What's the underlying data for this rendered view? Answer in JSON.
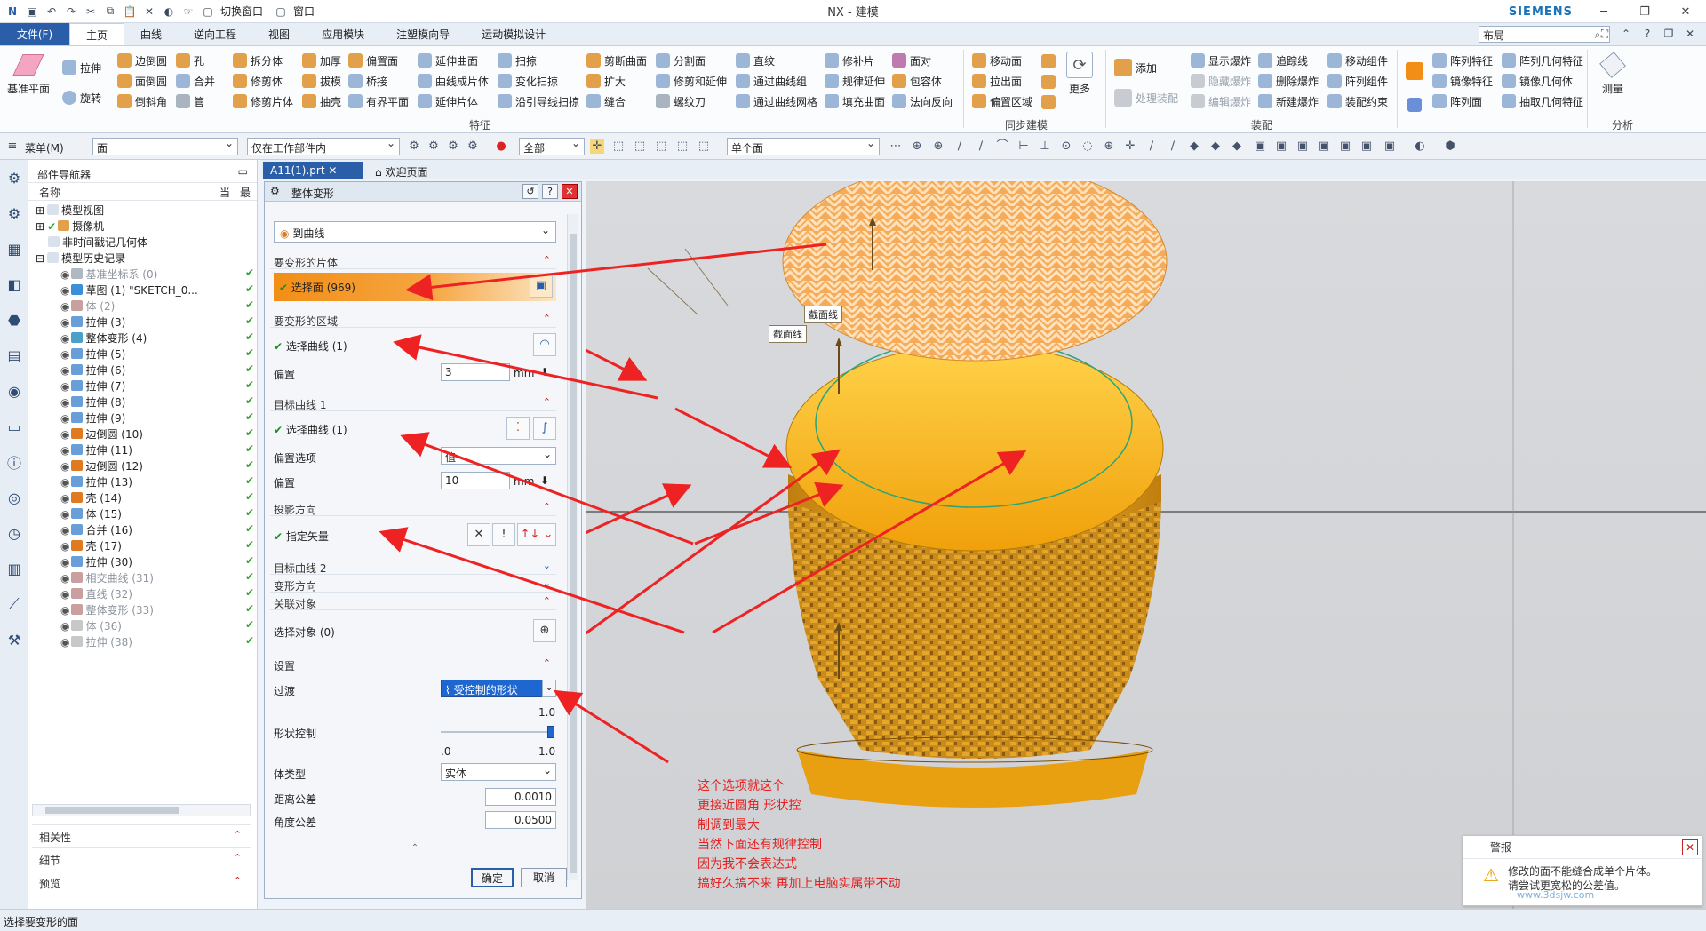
{
  "titlebar": {
    "title": "NX - 建模",
    "brand": "SIEMENS",
    "switch_window": "切换窗口",
    "window": "窗口"
  },
  "tabs": {
    "file": "文件(F)",
    "items": [
      "主页",
      "曲线",
      "逆向工程",
      "视图",
      "应用模块",
      "注塑模向导",
      "运动模拟设计"
    ],
    "search_value": "布局"
  },
  "ribbon": {
    "big": {
      "datum_plane": "基准平面",
      "extrude": "拉伸",
      "revolve": "旋转",
      "add": "添加",
      "process_assembly": "处理装配",
      "more": "更多",
      "measure": "测量"
    },
    "col1": [
      "边倒圆",
      "面倒圆",
      "倒斜角"
    ],
    "col2": [
      "孔",
      "合并",
      "管"
    ],
    "col3": [
      "拆分体",
      "修剪体",
      "修剪片体"
    ],
    "col4": [
      "加厚",
      "拔模",
      "抽壳"
    ],
    "col5": [
      "偏置面",
      "桥接",
      "有界平面"
    ],
    "col6": [
      "延伸曲面",
      "曲线成片体",
      "延伸片体"
    ],
    "col7": [
      "扫掠",
      "变化扫掠",
      "沿引导线扫掠"
    ],
    "col8": [
      "剪断曲面",
      "扩大",
      "缝合"
    ],
    "col9": [
      "分割面",
      "修剪和延伸",
      "螺纹刀"
    ],
    "col10": [
      "直纹",
      "通过曲线组",
      "通过曲线网格"
    ],
    "col11": [
      "修补片",
      "规律延伸",
      "填充曲面"
    ],
    "col12": [
      "面对",
      "包容体",
      "法向反向"
    ],
    "col13": [
      "移动面",
      "拉出面",
      "偏置区域"
    ],
    "col14": [
      "显示爆炸",
      "隐藏爆炸",
      "编辑爆炸"
    ],
    "col15": [
      "追踪线",
      "删除爆炸",
      "新建爆炸"
    ],
    "col16": [
      "移动组件",
      "阵列组件",
      "装配约束"
    ],
    "col17": [
      "阵列特征",
      "镜像特征",
      "阵列面"
    ],
    "col18": [
      "阵列几何特征",
      "镜像几何体",
      "抽取几何特征"
    ],
    "groups": [
      "特征",
      "同步建模",
      "装配",
      "分析"
    ]
  },
  "selbar": {
    "menu": "菜单(M)",
    "filter": "面",
    "scope": "仅在工作部件内",
    "all": "全部",
    "single_face": "单个面"
  },
  "navigator": {
    "title": "部件导航器",
    "col_name": "名称",
    "col_current": "当",
    "col_latest": "最",
    "top_items": [
      "模型视图",
      "摄像机",
      "非时间戳记几何体",
      "模型历史记录"
    ],
    "history": [
      {
        "label": "基准坐标系 (0)",
        "dim": true,
        "color": "#b0b8c2"
      },
      {
        "label": "草图 (1) \"SKETCH_0...",
        "dim": false,
        "color": "#3a8fd8"
      },
      {
        "label": "体 (2)",
        "dim": true,
        "color": "#c8a0a0"
      },
      {
        "label": "拉伸 (3)",
        "dim": false,
        "color": "#6a9ed8"
      },
      {
        "label": "整体变形 (4)",
        "dim": false,
        "color": "#4aa0c8"
      },
      {
        "label": "拉伸 (5)",
        "dim": false,
        "color": "#6a9ed8"
      },
      {
        "label": "拉伸 (6)",
        "dim": false,
        "color": "#6a9ed8"
      },
      {
        "label": "拉伸 (7)",
        "dim": false,
        "color": "#6a9ed8"
      },
      {
        "label": "拉伸 (8)",
        "dim": false,
        "color": "#6a9ed8"
      },
      {
        "label": "拉伸 (9)",
        "dim": false,
        "color": "#6a9ed8"
      },
      {
        "label": "边倒圆 (10)",
        "dim": false,
        "color": "#e07a20"
      },
      {
        "label": "拉伸 (11)",
        "dim": false,
        "color": "#6a9ed8"
      },
      {
        "label": "边倒圆 (12)",
        "dim": false,
        "color": "#e07a20"
      },
      {
        "label": "拉伸 (13)",
        "dim": false,
        "color": "#6a9ed8"
      },
      {
        "label": "壳 (14)",
        "dim": false,
        "color": "#e07a20"
      },
      {
        "label": "体 (15)",
        "dim": false,
        "color": "#6a9ed8"
      },
      {
        "label": "合并 (16)",
        "dim": false,
        "color": "#6a9ed8"
      },
      {
        "label": "壳 (17)",
        "dim": false,
        "color": "#e07a20"
      },
      {
        "label": "拉伸 (30)",
        "dim": false,
        "color": "#6a9ed8"
      },
      {
        "label": "相交曲线 (31)",
        "dim": true,
        "color": "#c8a0a0"
      },
      {
        "label": "直线 (32)",
        "dim": true,
        "color": "#c8a0a0"
      },
      {
        "label": "整体变形 (33)",
        "dim": true,
        "color": "#c8a0a0"
      },
      {
        "label": "体 (36)",
        "dim": true,
        "color": "#c8c8c8"
      },
      {
        "label": "拉伸 (38)",
        "dim": true,
        "color": "#c8c8c8"
      }
    ],
    "panels": [
      "相关性",
      "细节",
      "预览"
    ]
  },
  "doctabs": {
    "active": "A11(1).prt",
    "welcome": "欢迎页面"
  },
  "dialog": {
    "title": "整体变形",
    "type_value": "到曲线",
    "sec_sheet": "要变形的片体",
    "select_face": "选择面 (969)",
    "sec_region": "要变形的区域",
    "select_curve_1": "选择曲线 (1)",
    "offset_label": "偏置",
    "offset_1": "3",
    "unit": "mm",
    "sec_target1": "目标曲线 1",
    "select_curve_2": "选择曲线 (1)",
    "offset_option_label": "偏置选项",
    "offset_option_value": "值",
    "offset_2": "10",
    "sec_projection": "投影方向",
    "specify_vector": "指定矢量",
    "sec_target2": "目标曲线 2",
    "sec_deform_dir": "变形方向",
    "sec_related": "关联对象",
    "select_object": "选择对象 (0)",
    "sec_settings": "设置",
    "transition_label": "过渡",
    "transition_value": "受控制的形状",
    "shape_control_label": "形状控制",
    "slider_max": "1.0",
    "slider_min": ".0",
    "slider_value": 1.0,
    "body_type_label": "体类型",
    "body_type_value": "实体",
    "dist_tol_label": "距离公差",
    "dist_tol_value": "0.0010",
    "angle_tol_label": "角度公差",
    "angle_tol_value": "0.0500",
    "ok": "确定",
    "cancel": "取消"
  },
  "viewport": {
    "section_line_1": "截面线",
    "section_line_2": "截面线",
    "annotation": [
      "这个选项就这个",
      "更接近圆角 形状控",
      "制调到最大",
      "当然下面还有规律控制",
      "因为我不会表达式",
      "搞好久搞不来  再加上电脑实属带不动"
    ],
    "alert_title": "警报",
    "alert_text": [
      "修改的面不能缝合成单个片体。",
      "请尝试更宽松的公差值。"
    ],
    "watermark": "www.3dsjw.com"
  },
  "status": {
    "prompt": "选择要变形的面"
  },
  "colors": {
    "accent": "#2a5ea8",
    "orange": "#f5a60f",
    "annotation_red": "#e52020"
  }
}
